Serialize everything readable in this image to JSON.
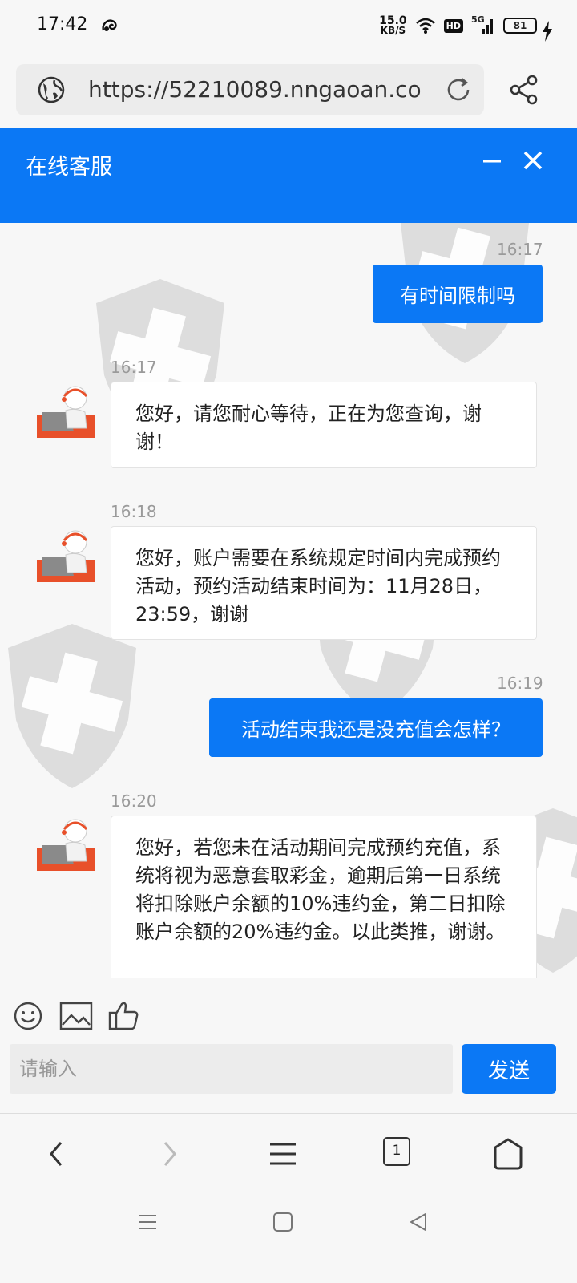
{
  "status_bar": {
    "time": "17:42",
    "net_speed_value": "15.0",
    "net_speed_unit": "KB/S",
    "hd_label": "HD",
    "network_label": "5G",
    "battery_level": "81"
  },
  "browser": {
    "url": "https://52210089.nngaoan.co",
    "tab_count": "1"
  },
  "chat": {
    "title": "在线客服",
    "messages": [
      {
        "sender": "user",
        "time": "16:17",
        "text": "有时间限制吗"
      },
      {
        "sender": "agent",
        "time": "16:17",
        "text": "您好，请您耐心等待，正在为您查询，谢谢！"
      },
      {
        "sender": "agent",
        "time": "16:18",
        "text": "您好，账户需要在系统规定时间内完成预约活动，预约活动结束时间为：11月28日，23:59，谢谢"
      },
      {
        "sender": "user",
        "time": "16:19",
        "text": "活动结束我还是没充值会怎样？"
      },
      {
        "sender": "agent",
        "time": "16:20",
        "text": "您好，若您未在活动期间完成预约充值，系统将视为恶意套取彩金，逾期后第一日系统将扣除账户余额的10%违约金，第二日扣除账户余额的20%违约金。以此类推，谢谢。"
      }
    ]
  },
  "composer": {
    "placeholder": "请输入",
    "send_label": "发送"
  },
  "colors": {
    "accent": "#0b78f5"
  }
}
